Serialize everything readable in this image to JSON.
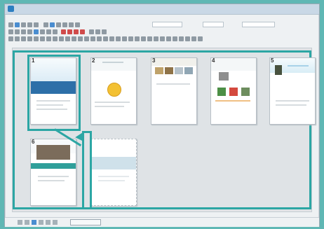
{
  "app": {
    "title": ""
  },
  "menu": {
    "items": [
      "",
      "",
      "",
      "",
      "",
      "",
      "",
      "",
      ""
    ]
  },
  "slides": {
    "numbers": [
      "1",
      "2",
      "3",
      "4",
      "5",
      "6"
    ]
  },
  "status": {
    "label": ""
  },
  "colors": {
    "accent": "#2ca6a4",
    "window_bg": "#eef1f3",
    "content_bg": "#dfe3e6"
  }
}
